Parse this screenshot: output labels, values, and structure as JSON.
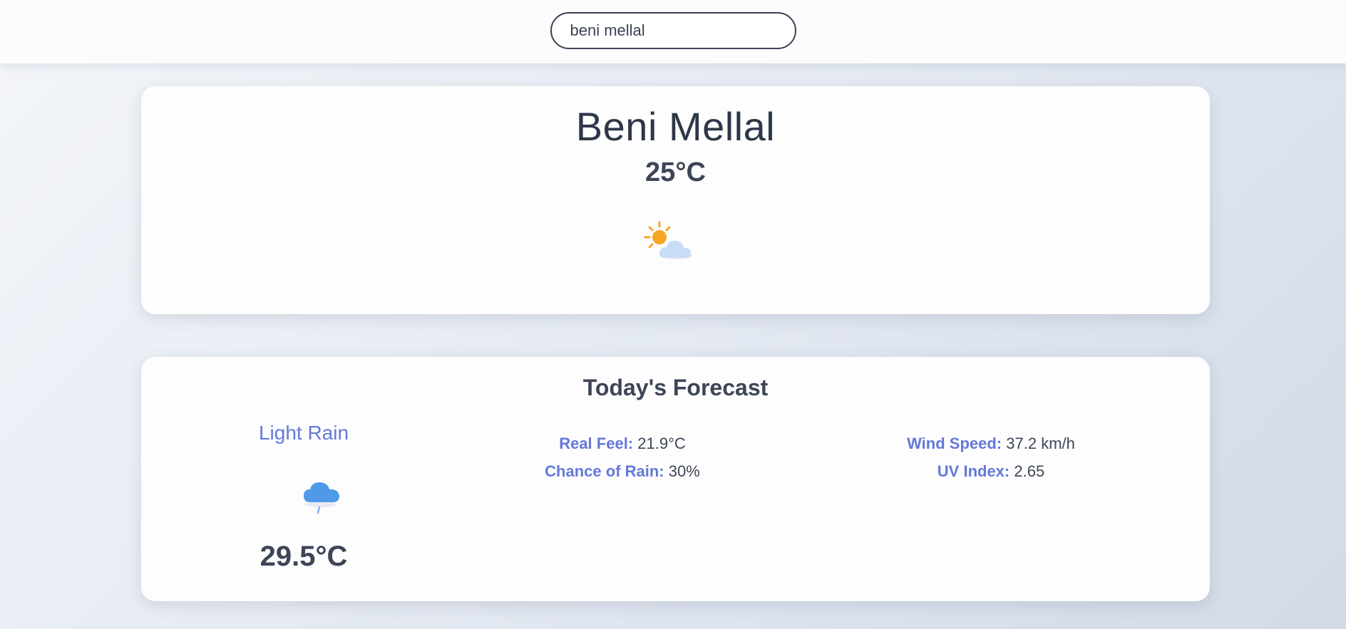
{
  "search": {
    "value": "beni mellal"
  },
  "current": {
    "city": "Beni Mellal",
    "temperature": "25°C",
    "icon": "partly-cloudy-day-icon"
  },
  "forecast": {
    "title": "Today's Forecast",
    "condition": "Light Rain",
    "icon": "light-rain-icon",
    "temperature": "29.5°C",
    "real_feel_label": "Real Feel:",
    "real_feel_value": "21.9°C",
    "chance_rain_label": "Chance of Rain:",
    "chance_rain_value": "30%",
    "wind_speed_label": "Wind Speed:",
    "wind_speed_value": "37.2 km/h",
    "uv_index_label": "UV Index:",
    "uv_index_value": "2.65"
  },
  "colors": {
    "accent": "#6379d9",
    "text_dark": "#2d3748",
    "sun": "#f5a623",
    "cloud_light": "#c9dcf7",
    "cloud_rain": "#4f9ae8"
  }
}
